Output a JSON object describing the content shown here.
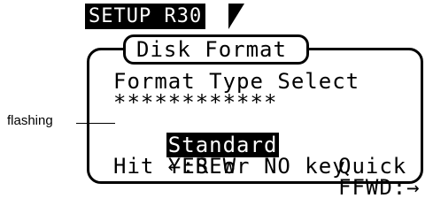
{
  "annotation": {
    "label": "flashing"
  },
  "screen": {
    "header": "SETUP R30",
    "title": "Disk Format",
    "line1": "Format Type Select",
    "line2": "************",
    "option_selected": "Standard",
    "option_other": "Quick",
    "nav_left": "←:REW",
    "nav_right": "FFWD:→",
    "prompt": "Hit YES or NO key"
  }
}
